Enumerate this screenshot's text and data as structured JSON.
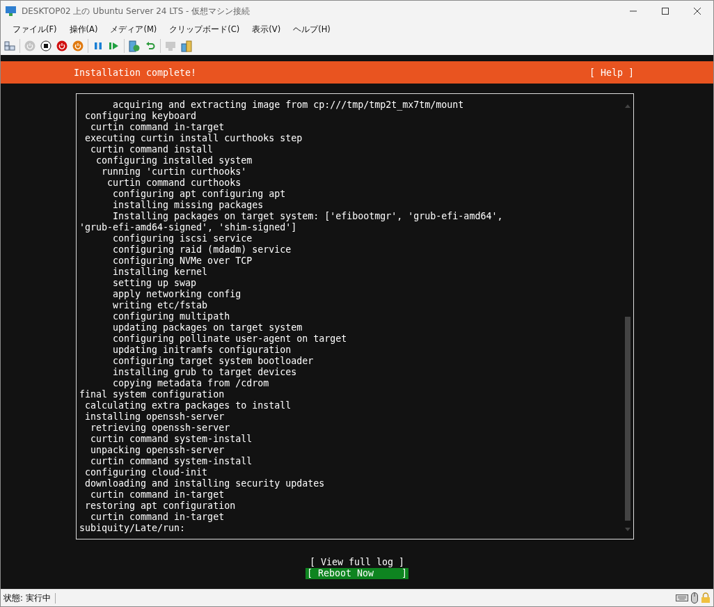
{
  "window": {
    "title": "DESKTOP02 上の Ubuntu Server 24 LTS  - 仮想マシン接続"
  },
  "menu": [
    "ファイル(F)",
    "操作(A)",
    "メディア(M)",
    "クリップボード(C)",
    "表示(V)",
    "ヘルプ(H)"
  ],
  "toolbar": [
    {
      "kind": "host",
      "disabled": false
    },
    {
      "kind": "sep"
    },
    {
      "kind": "power",
      "disabled": true
    },
    {
      "kind": "stop",
      "disabled": false
    },
    {
      "kind": "shutdown",
      "disabled": false
    },
    {
      "kind": "save",
      "disabled": false
    },
    {
      "kind": "sep"
    },
    {
      "kind": "pause",
      "disabled": false
    },
    {
      "kind": "resume",
      "disabled": false
    },
    {
      "kind": "sep"
    },
    {
      "kind": "checkpoint",
      "disabled": false
    },
    {
      "kind": "revert",
      "disabled": false
    },
    {
      "kind": "sep"
    },
    {
      "kind": "session",
      "disabled": true
    },
    {
      "kind": "share",
      "disabled": false
    }
  ],
  "installer": {
    "header": "Installation complete!",
    "help": "[ Help ]",
    "log": [
      "      acquiring and extracting image from cp:///tmp/tmp2t_mx7tm/mount",
      " configuring keyboard",
      "  curtin command in-target",
      " executing curtin install curthooks step",
      "  curtin command install",
      "   configuring installed system",
      "    running 'curtin curthooks'",
      "     curtin command curthooks",
      "      configuring apt configuring apt",
      "      installing missing packages",
      "      Installing packages on target system: ['efibootmgr', 'grub-efi-amd64',",
      "'grub-efi-amd64-signed', 'shim-signed']",
      "      configuring iscsi service",
      "      configuring raid (mdadm) service",
      "      configuring NVMe over TCP",
      "      installing kernel",
      "      setting up swap",
      "      apply networking config",
      "      writing etc/fstab",
      "      configuring multipath",
      "      updating packages on target system",
      "      configuring pollinate user-agent on target",
      "      updating initramfs configuration",
      "      configuring target system bootloader",
      "      installing grub to target devices",
      "      copying metadata from /cdrom",
      "final system configuration",
      " calculating extra packages to install",
      " installing openssh-server",
      "  retrieving openssh-server",
      "  curtin command system-install",
      "  unpacking openssh-server",
      "  curtin command system-install",
      " configuring cloud-init",
      " downloading and installing security updates",
      "  curtin command in-target",
      " restoring apt configuration",
      "  curtin command in-target",
      "subiquity/Late/run:"
    ],
    "buttons": [
      {
        "label": "[ View full log ]",
        "selected": false
      },
      {
        "label": "[ Reboot Now     ]",
        "selected": true
      }
    ]
  },
  "status_bar": {
    "text": "状態: 実行中"
  }
}
